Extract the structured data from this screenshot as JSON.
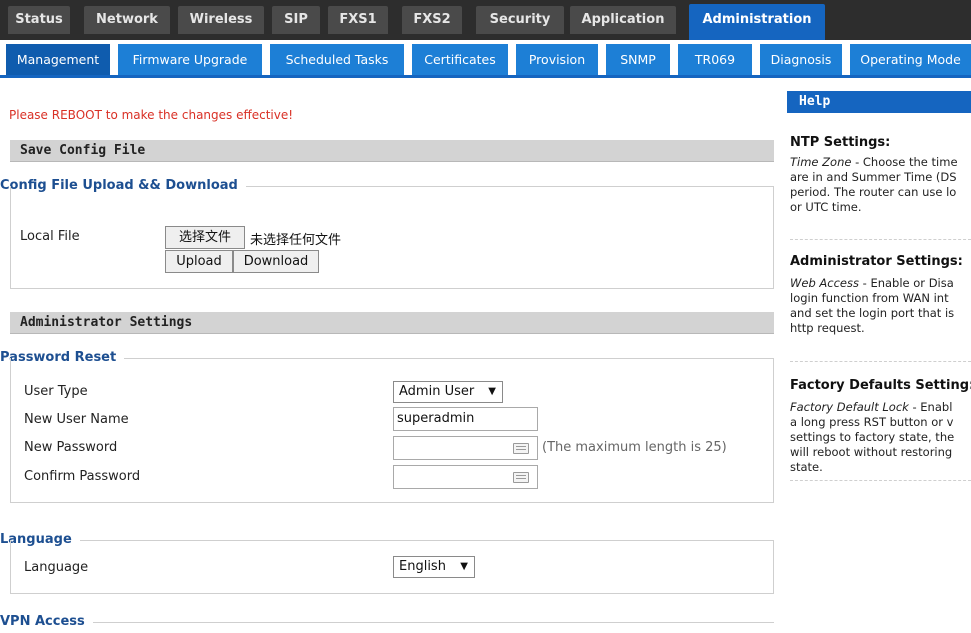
{
  "top_tabs": [
    "Status",
    "Network",
    "Wireless",
    "SIP",
    "FXS1",
    "FXS2",
    "Security",
    "Application",
    "Administration"
  ],
  "sub_tabs": [
    "Management",
    "Firmware Upgrade",
    "Scheduled Tasks",
    "Certificates",
    "Provision",
    "SNMP",
    "TR069",
    "Diagnosis",
    "Operating Mode"
  ],
  "notice": "Please REBOOT to make the changes effective!",
  "save_config": {
    "title": "Save Config File",
    "legend": "Config File Upload && Download",
    "local_file_label": "Local File",
    "choose_file_label": "选择文件",
    "no_file_text": "未选择任何文件",
    "upload_label": "Upload",
    "download_label": "Download"
  },
  "admin": {
    "title": "Administrator Settings",
    "legend": "Password Reset",
    "user_type_label": "User Type",
    "user_type_value": "Admin User",
    "new_user_name_label": "New User Name",
    "new_user_name_value": "superadmin",
    "new_password_label": "New Password",
    "new_password_hint": "(The maximum length is 25)",
    "confirm_password_label": "Confirm Password"
  },
  "language": {
    "legend": "Language",
    "label": "Language",
    "value": "English"
  },
  "vpn": {
    "legend": "VPN Access"
  },
  "help": {
    "header": "Help",
    "ntp_title": "NTP Settings:",
    "ntp_lines": [
      "Time Zone - Choose the time",
      "are in and Summer Time (DS",
      "period. The router can use lo",
      "or UTC time."
    ],
    "admin_title": "Administrator Settings:",
    "admin_lines": [
      "Web Access - Enable or Disa",
      "login function from WAN int",
      "and set the login port that is",
      "http request."
    ],
    "factory_title": "Factory Defaults Setting:",
    "factory_lines": [
      "Factory Default Lock - Enabl",
      "a long press RST button or v",
      "settings to factory state, the",
      "will reboot without restoring",
      "state."
    ]
  },
  "colors": {
    "accent": "#1565c0",
    "subtab": "#1d7fd6",
    "notice": "#d93025",
    "legend": "#1d4f91"
  }
}
